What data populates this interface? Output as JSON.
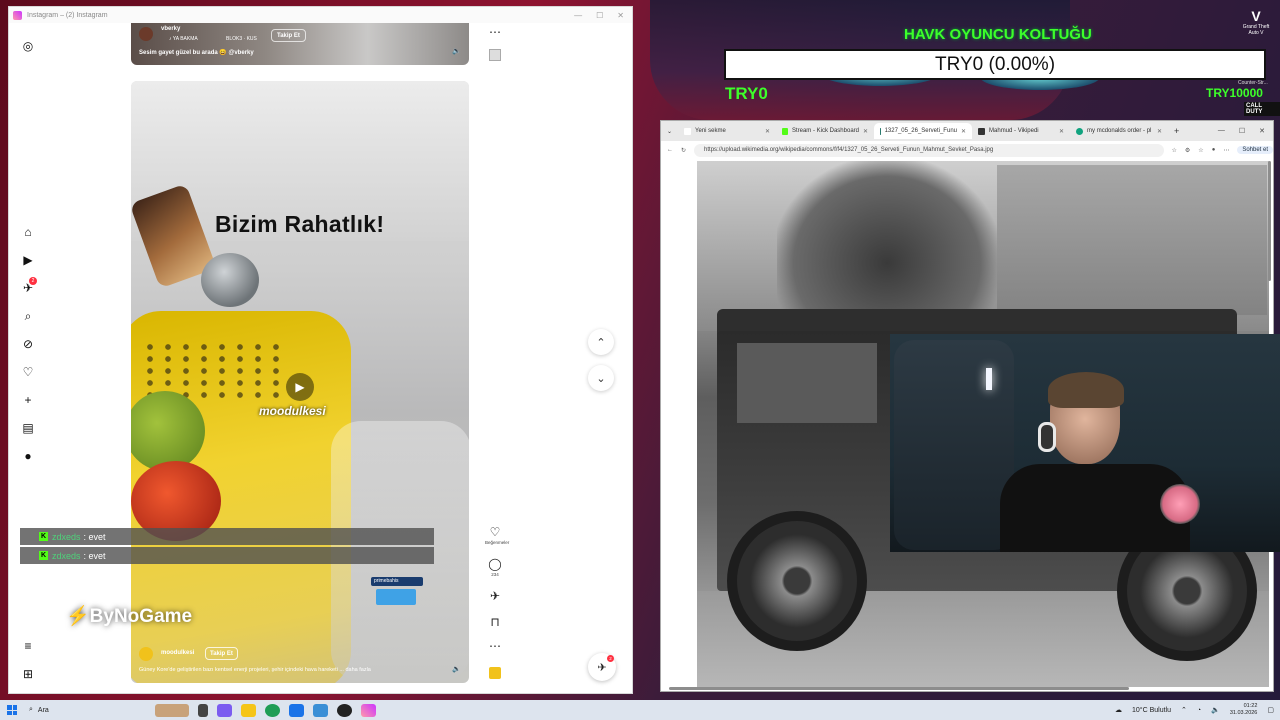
{
  "overlay": {
    "title": "HAVK OYUNCU KOLTUĞU",
    "bar_text": "TRY0 (0.00%)",
    "left_amount": "TRY0",
    "right_amount": "TRY10000",
    "gta_label": "Grand Theft Auto V",
    "cs_label": "Counter-Str...",
    "cod_label": "CALL DUTY",
    "accent": "#3dff2a"
  },
  "instagram": {
    "window_title": "Instagram – (2) Instagram",
    "nav_badge": "2",
    "top_reel": {
      "user": "vberky",
      "sub1": "♪ YA BAKMA",
      "sub2": "BLOK3 · KUS",
      "follow": "Takip Et",
      "caption": "Sesim gayet güzel bu arada 😄 @vberky"
    },
    "reel": {
      "title": "Bizim Rahatlık!",
      "watermark": "moodulkesi",
      "promo": "primebahis",
      "user": "moodulkesi",
      "follow": "Takip Et",
      "caption": "Güney Kore'de geliştirilen bazı kentsel enerji projeleri, şehir içindeki hava hareketi ... daha fazla"
    },
    "actions": {
      "like_label": "Beğenmeler",
      "comment_count": "234"
    },
    "fab_badge": "2"
  },
  "chat": {
    "lines": [
      {
        "user": "zdxeds",
        "text": ": evet"
      },
      {
        "user": "zdxeds",
        "text": ": evet"
      }
    ],
    "brand": "ByNoGame"
  },
  "browser": {
    "tabs": [
      {
        "label": "Yeni sekme",
        "color": "#ffffff"
      },
      {
        "label": "Stream - Kick Dashboard",
        "color": "#53fc18"
      },
      {
        "label": "1327_05_26_Serveti_Funu",
        "color": "#2a7a6e"
      },
      {
        "label": "Mahmud - Vikipedi",
        "color": "#333333"
      },
      {
        "label": "my mcdonalds order - pl",
        "color": "#11a37f"
      }
    ],
    "url": "https://upload.wikimedia.org/wikipedia/commons/f/f4/1327_05_26_Serveti_Funun_Mahmut_Sevket_Pasa.jpg",
    "chat_btn": "Sohbet et"
  },
  "taskbar": {
    "search": "Ara",
    "weather": "10°C  Bulutlu",
    "time": "01:22",
    "date": "31.03.2026"
  }
}
